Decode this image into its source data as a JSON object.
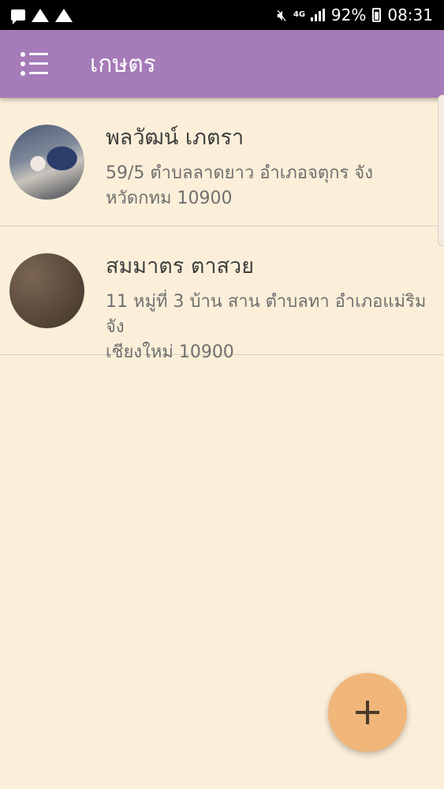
{
  "status_bar": {
    "battery": "92%",
    "time": "08:31",
    "network": "4G",
    "icons": [
      "message-icon",
      "warning-icon",
      "warning-icon",
      "mute-icon",
      "signal-icon",
      "battery-icon"
    ]
  },
  "app_bar": {
    "title": "เกษตร",
    "color": "#a57bb8"
  },
  "farmers": [
    {
      "name": "พลวัฒน์ เภตรา",
      "address": "59/5 ตำบลลาดยาว อำเภอจตุกร จัง\nหวัดกทม 10900"
    },
    {
      "name": "สมมาตร ตาสวย",
      "address": "11 หมู่ที่ 3 บ้าน สาน ตำบลทา อำเภอแม่ริม จัง\nเชียงใหม่ 10900"
    }
  ],
  "fab": {
    "icon": "plus-icon",
    "color": "#f1b679"
  },
  "background_color": "#fbefd9"
}
